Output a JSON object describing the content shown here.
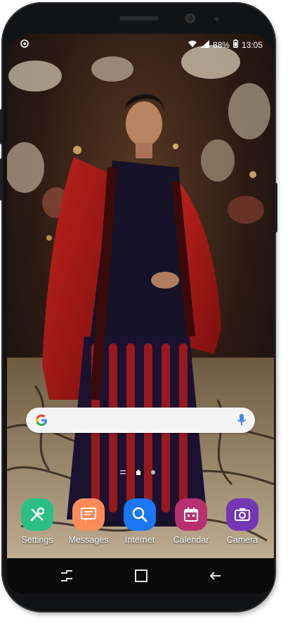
{
  "status": {
    "battery_percent": "88%",
    "time": "13:05"
  },
  "colors": {
    "settings": "#2bbf84",
    "messages": "#ff8b5b",
    "internet": "#1a76f2",
    "calendar": "#b8306f",
    "camera": "#7336b5"
  },
  "dock": {
    "apps": [
      {
        "label": "Settings",
        "icon": "settings-icon"
      },
      {
        "label": "Messages",
        "icon": "messages-icon"
      },
      {
        "label": "Internet",
        "icon": "internet-icon"
      },
      {
        "label": "Calendar",
        "icon": "calendar-icon"
      },
      {
        "label": "Camera",
        "icon": "camera-icon"
      }
    ]
  },
  "navbar": {
    "buttons": [
      "recent-apps-icon",
      "home-icon",
      "back-icon"
    ]
  }
}
